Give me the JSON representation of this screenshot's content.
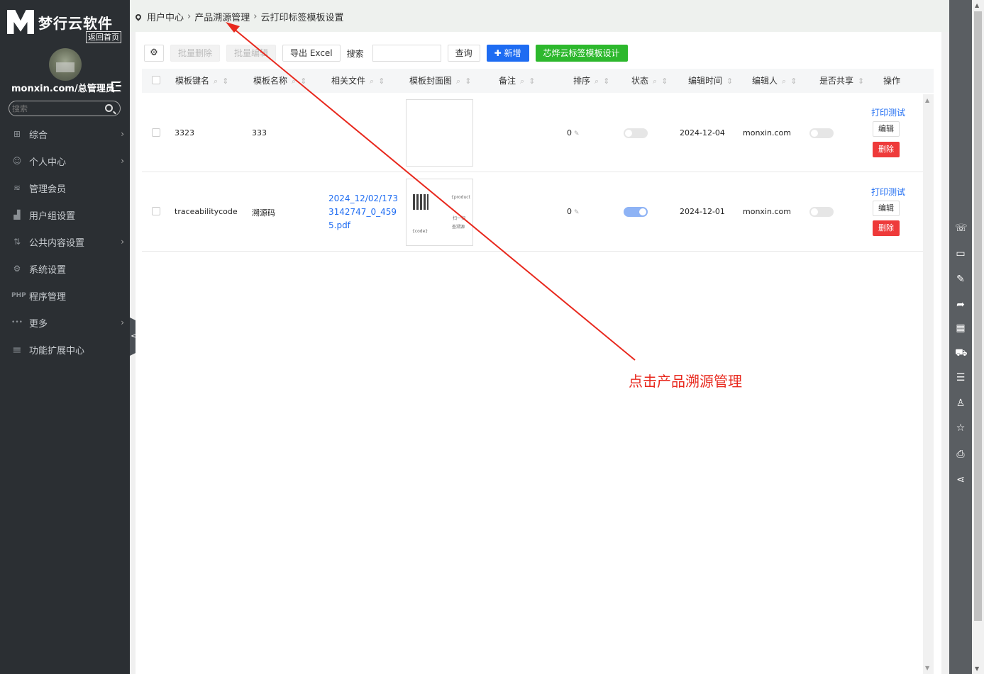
{
  "brand": {
    "logo_letter": "M",
    "name": "梦行云软件",
    "back_home": "返回首页"
  },
  "user": {
    "name": "monxin.com/总管理员"
  },
  "sidebar": {
    "search_placeholder": "搜索",
    "items": [
      {
        "label": "综合",
        "icon": "grid-icon",
        "glyph": "⊞",
        "has_arrow": true
      },
      {
        "label": "个人中心",
        "icon": "person-icon",
        "glyph": "☺",
        "has_arrow": true
      },
      {
        "label": "管理会员",
        "icon": "layers-icon",
        "glyph": "≋",
        "has_arrow": false
      },
      {
        "label": "用户组设置",
        "icon": "bar-chart-icon",
        "glyph": "▟",
        "has_arrow": false
      },
      {
        "label": "公共内容设置",
        "icon": "sort-icon",
        "glyph": "⇅",
        "has_arrow": true
      },
      {
        "label": "系统设置",
        "icon": "gear-icon",
        "glyph": "⚙",
        "has_arrow": false
      },
      {
        "label": "程序管理",
        "icon": "php-icon",
        "glyph": "PHP",
        "has_arrow": false
      },
      {
        "label": "更多",
        "icon": "dots-icon",
        "glyph": "•••",
        "has_arrow": true
      },
      {
        "label": "功能扩展中心",
        "icon": "menu-icon",
        "glyph": "≡",
        "has_arrow": false
      }
    ],
    "chevron": "›",
    "collapse_glyph": "<"
  },
  "breadcrumb": {
    "items": [
      "用户中心",
      "产品溯源管理",
      "云打印标签模板设置"
    ],
    "separator": "›"
  },
  "toolbar": {
    "gear_glyph": "⚙",
    "batch_delete": "批量删除",
    "batch_edit": "批量编辑",
    "export": "导出 Excel",
    "search_label": "搜索",
    "search_value": "",
    "query": "查询",
    "add": "✚ 新增",
    "design": "芯烨云标签模板设计"
  },
  "table": {
    "headers": [
      "模板键名",
      "模板名称",
      "相关文件",
      "模板封面图",
      "备注",
      "排序",
      "状态",
      "编辑时间",
      "编辑人",
      "是否共享",
      "操作"
    ],
    "search_glyph": "🔍",
    "sort_glyph": "⇕",
    "rows": [
      {
        "key": "3323",
        "name": "333",
        "file": [
          "",
          "",
          ""
        ],
        "has_qr": false,
        "thumb_text_a": "",
        "thumb_text_b": "",
        "thumb_text_c": "",
        "thumb_text_d": "",
        "remark": "",
        "sort": "0",
        "status_on": false,
        "edit_time": "2024-12-04",
        "editor": "monxin.com",
        "shared": false,
        "print": "打印测试",
        "edit": "编辑",
        "delete": "删除"
      },
      {
        "key": "traceabilitycode",
        "name": "溯源码",
        "file": [
          "2024_12/02/173",
          "3142747_0_459",
          "5.pdf"
        ],
        "has_qr": true,
        "thumb_text_a": "{product",
        "thumb_text_b": "扫一扫",
        "thumb_text_c": "查溯源",
        "thumb_text_d": "{code}",
        "remark": "",
        "sort": "0",
        "status_on": true,
        "edit_time": "2024-12-01",
        "editor": "monxin.com",
        "shared": false,
        "print": "打印测试",
        "edit": "编辑",
        "delete": "删除"
      }
    ]
  },
  "annotation": {
    "text": "点击产品溯源管理",
    "color": "#e8281d"
  },
  "right_bar": {
    "icons": [
      {
        "name": "wechat-icon",
        "glyph": "☏"
      },
      {
        "name": "message-icon",
        "glyph": "▭"
      },
      {
        "name": "edit-icon",
        "glyph": "✎"
      },
      {
        "name": "share-icon",
        "glyph": "➦"
      },
      {
        "name": "qrcode-icon",
        "glyph": "▦"
      },
      {
        "name": "cart-icon",
        "glyph": "⛟"
      },
      {
        "name": "list-icon",
        "glyph": "☰"
      },
      {
        "name": "user-icon",
        "glyph": "♙"
      },
      {
        "name": "star-icon",
        "glyph": "☆"
      },
      {
        "name": "printer-icon",
        "glyph": "⎙"
      },
      {
        "name": "share-nodes-icon",
        "glyph": "⋖"
      }
    ]
  },
  "colors": {
    "primary": "#1e6cf2",
    "success": "#2db82d",
    "danger": "#ee3a3a",
    "sidebar": "#2b2f33"
  }
}
